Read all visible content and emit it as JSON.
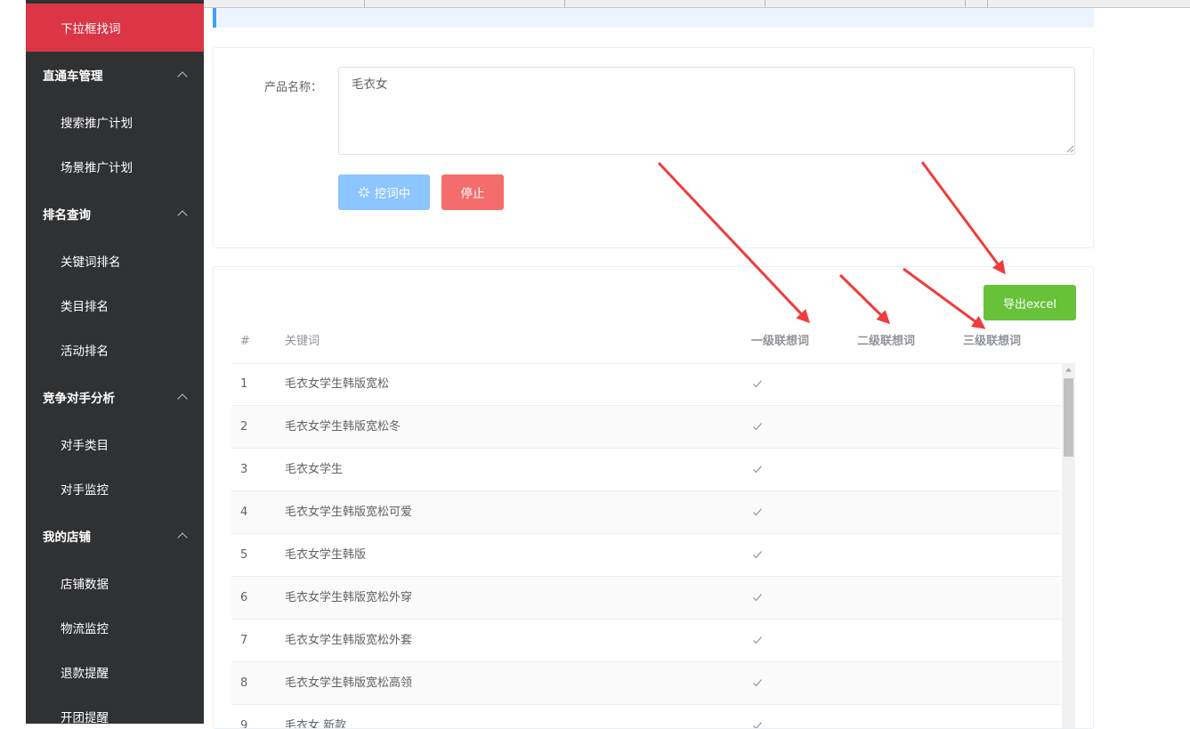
{
  "sidebar": {
    "items": [
      {
        "label": "下拉框找词",
        "kind": "active"
      },
      {
        "label": "直通车管理",
        "kind": "group"
      },
      {
        "label": "搜索推广计划",
        "kind": "sub"
      },
      {
        "label": "场景推广计划",
        "kind": "sub"
      },
      {
        "label": "排名查询",
        "kind": "group"
      },
      {
        "label": "关键词排名",
        "kind": "sub"
      },
      {
        "label": "类目排名",
        "kind": "sub"
      },
      {
        "label": "活动排名",
        "kind": "sub"
      },
      {
        "label": "竞争对手分析",
        "kind": "group"
      },
      {
        "label": "对手类目",
        "kind": "sub"
      },
      {
        "label": "对手监控",
        "kind": "sub"
      },
      {
        "label": "我的店铺",
        "kind": "group"
      },
      {
        "label": "店铺数据",
        "kind": "sub"
      },
      {
        "label": "物流监控",
        "kind": "sub"
      },
      {
        "label": "退款提醒",
        "kind": "sub"
      },
      {
        "label": "开团提醒",
        "kind": "sub"
      }
    ]
  },
  "form": {
    "product_label": "产品名称：",
    "product_value": "毛衣女",
    "mining_button": "挖词中",
    "stop_button": "停止"
  },
  "table": {
    "export_button": "导出excel",
    "headers": {
      "index": "#",
      "keyword": "关键词",
      "level1": "一级联想词",
      "level2": "二级联想词",
      "level3": "三级联想词"
    },
    "rows": [
      {
        "index": "1",
        "keyword": "毛衣女学生韩版宽松",
        "level1": true
      },
      {
        "index": "2",
        "keyword": "毛衣女学生韩版宽松冬",
        "level1": true
      },
      {
        "index": "3",
        "keyword": "毛衣女学生",
        "level1": true
      },
      {
        "index": "4",
        "keyword": "毛衣女学生韩版宽松可爱",
        "level1": true
      },
      {
        "index": "5",
        "keyword": "毛衣女学生韩版",
        "level1": true
      },
      {
        "index": "6",
        "keyword": "毛衣女学生韩版宽松外穿",
        "level1": true
      },
      {
        "index": "7",
        "keyword": "毛衣女学生韩版宽松外套",
        "level1": true
      },
      {
        "index": "8",
        "keyword": "毛衣女学生韩版宽松高领",
        "level1": true
      },
      {
        "index": "9",
        "keyword": "毛衣女 新款",
        "level1": true
      }
    ]
  },
  "colors": {
    "sidebar_bg": "#303133",
    "active_item": "#dc3545",
    "mining_button": "#8cc5ff",
    "stop_button": "#f56c6c",
    "export_button": "#67c23a",
    "annotation_arrow": "#f03c3c"
  },
  "icons": {
    "mining": "loading-spinner-icon",
    "check": "check-icon",
    "chevron": "chevron-up-icon"
  }
}
